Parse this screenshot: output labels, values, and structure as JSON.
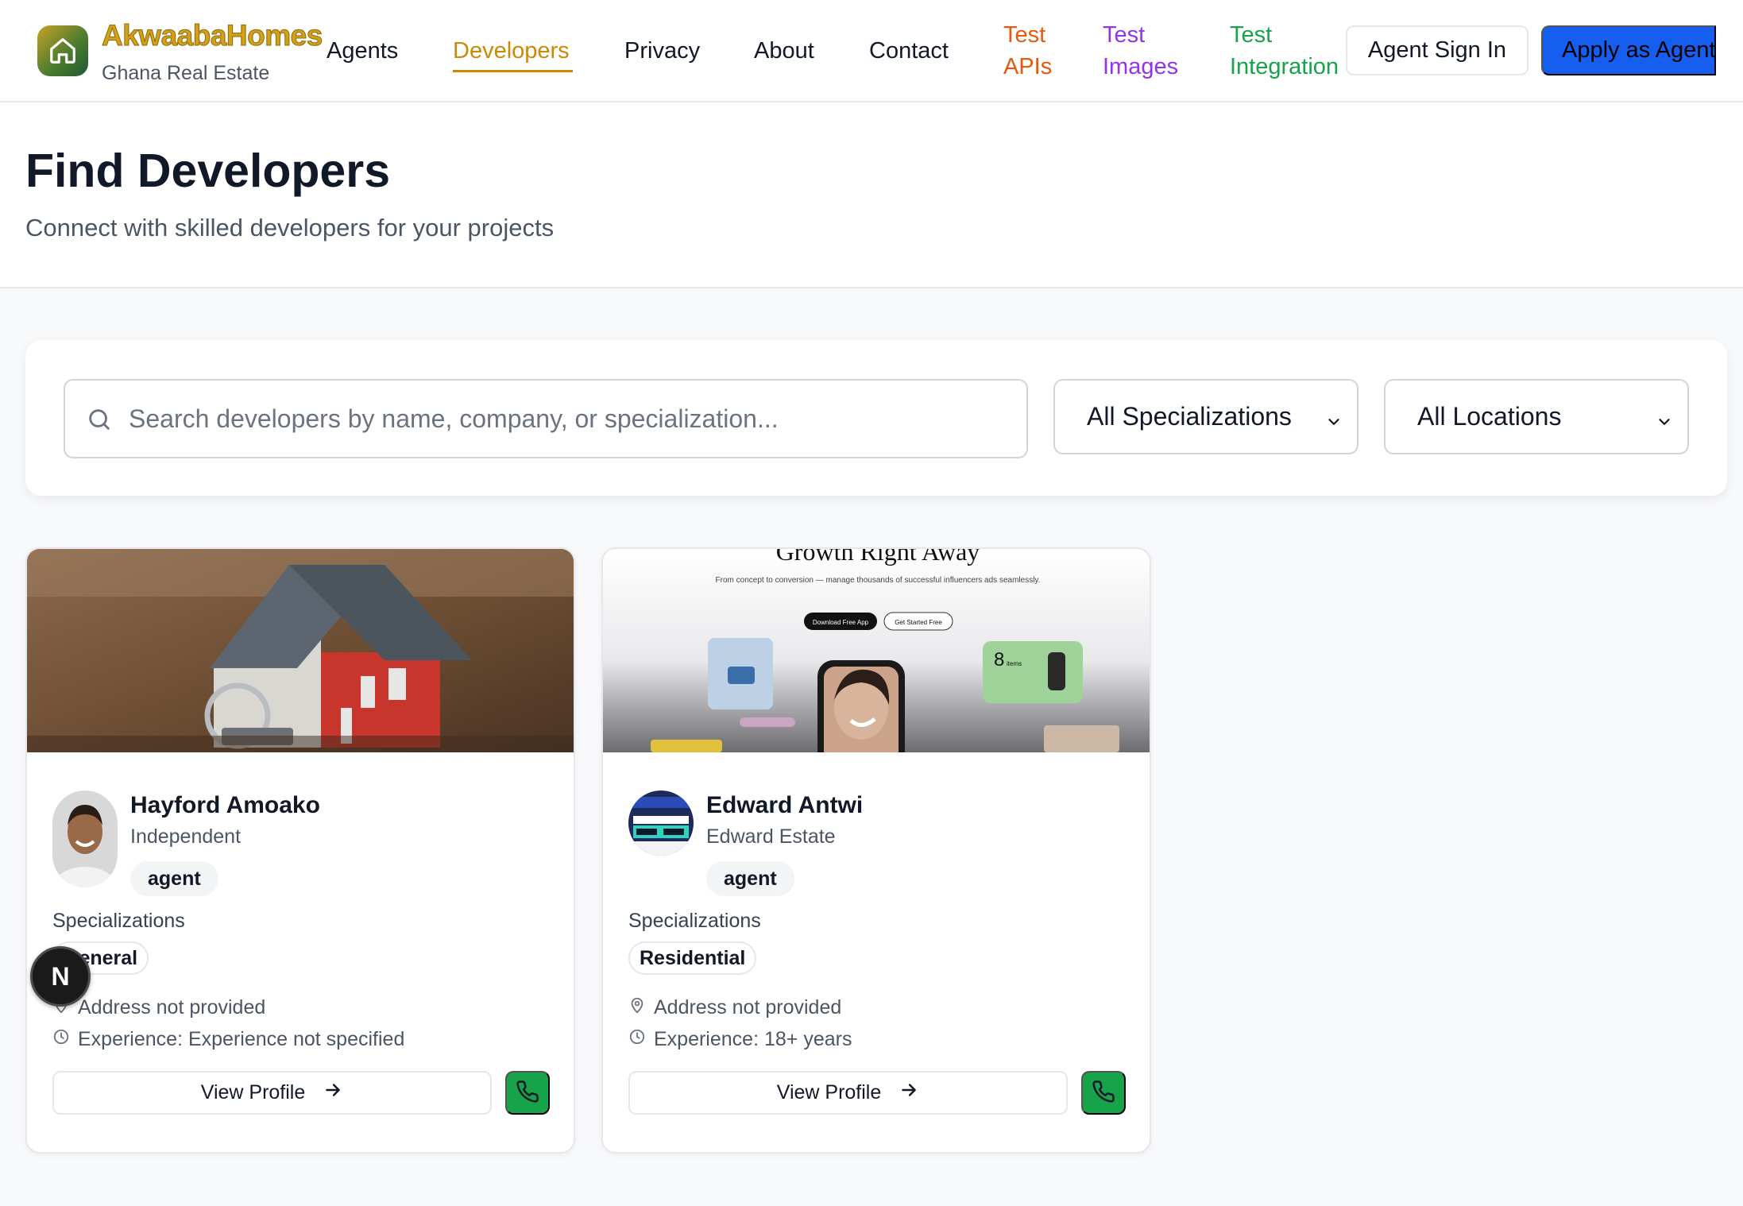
{
  "header": {
    "brand": "AkwaabaHomes",
    "tagline": "Ghana Real Estate",
    "nav": {
      "agents": "Agents",
      "developers": "Developers",
      "privacy": "Privacy",
      "about": "About",
      "contact": "Contact",
      "test_apis_line1": "Test",
      "test_apis_line2": "APIs",
      "test_images_line1": "Test",
      "test_images_line2": "Images",
      "test_integration_line1": "Test",
      "test_integration_line2": "Integration"
    },
    "agent_sign_in": "Agent Sign In",
    "apply_as_agent": "Apply as Agent"
  },
  "hero": {
    "title": "Find Developers",
    "subtitle": "Connect with skilled developers for your projects"
  },
  "filters": {
    "search_placeholder": "Search developers by name, company, or specialization...",
    "specialization_selected": "All Specializations",
    "location_selected": "All Locations"
  },
  "developers": [
    {
      "name": "Hayford Amoako",
      "company": "Independent",
      "role": "agent",
      "specializations_label": "Specializations",
      "specialization": "General",
      "address": "Address not provided",
      "experience": "Experience: Experience not specified",
      "view_profile": "View Profile"
    },
    {
      "name": "Edward Antwi",
      "company": "Edward Estate",
      "role": "agent",
      "specializations_label": "Specializations",
      "specialization": "Residential",
      "address": "Address not provided",
      "experience": "Experience: 18+ years",
      "view_profile": "View Profile"
    }
  ],
  "cover2": {
    "headline": "Growth Right Away",
    "text": "From concept to conversion — manage thousands of successful influencers ads seamlessly.",
    "btn1": "Download Free App",
    "btn2": "Get Started Free",
    "stat": "8",
    "stat_unit": "items"
  },
  "dev_badge": "N",
  "colors": {
    "accent": "#ca8a04",
    "test_apis": "#ea580c",
    "test_images": "#9333ea",
    "test_integration": "#16a34a",
    "apply_button": "#155eef",
    "call_button": "#16a34a"
  }
}
